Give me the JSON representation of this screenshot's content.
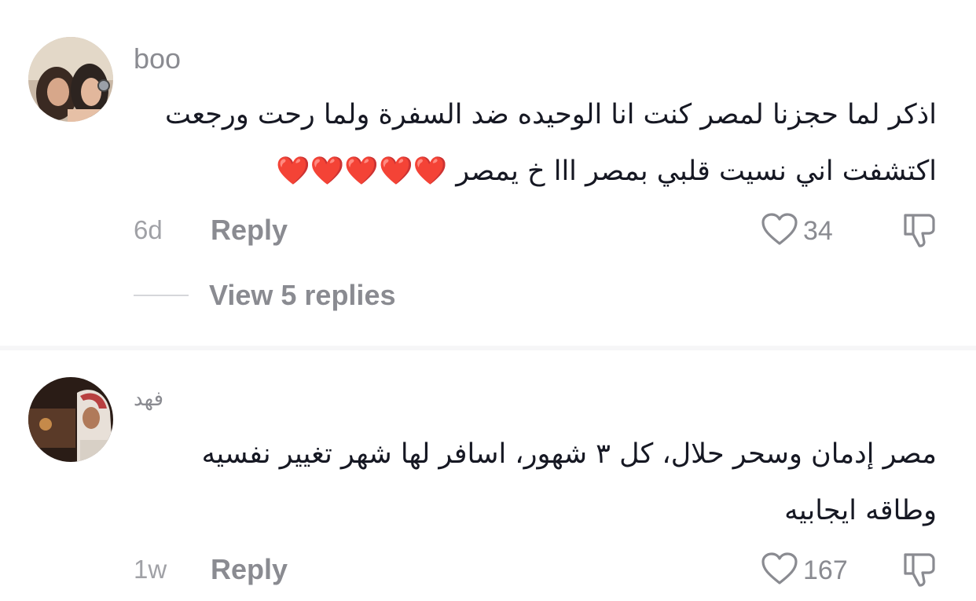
{
  "comments": [
    {
      "username": "boo",
      "text_line1": "اذكر لما حجزنا لمصر كنت انا الوحيده ضد السفرة ولما رحت ورجعت",
      "text_line2": "اكتشفت اني نسيت قلبي بمصر ااا خ يمصر ❤️❤️❤️❤️❤️",
      "timestamp": "6d",
      "reply_label": "Reply",
      "like_count": "34",
      "view_replies_label": "View 5 replies"
    },
    {
      "username": "فهد",
      "text_line1": "مصر إدمان وسحر حلال، كل ٣ شهور، اسافر لها شهر تغيير نفسيه",
      "text_line2": "وطاقه ايجابيه",
      "timestamp": "1w",
      "reply_label": "Reply",
      "like_count": "167"
    }
  ],
  "icons": {
    "like": "heart-outline-icon",
    "dislike": "thumbs-down-icon"
  },
  "colors": {
    "text": "#161823",
    "muted": "#8a8b91",
    "heart_emoji": "#e0202b"
  }
}
